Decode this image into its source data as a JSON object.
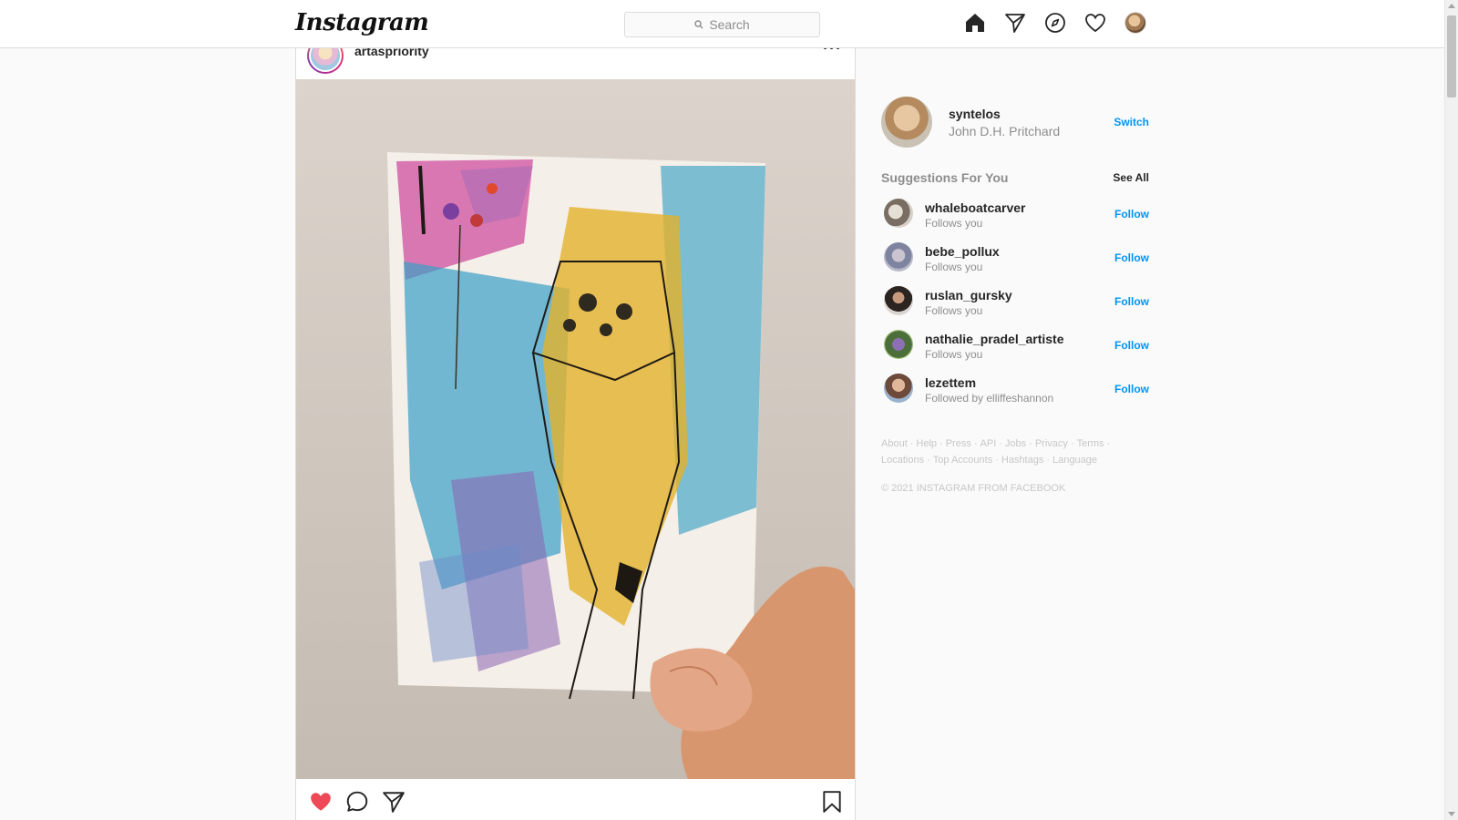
{
  "app": {
    "logo_text": "Instagram",
    "search_placeholder": "Search",
    "nav_icons": [
      "home-icon",
      "direct-icon",
      "explore-icon",
      "activity-heart-icon",
      "profile-avatar"
    ]
  },
  "post": {
    "username": "artaspriority",
    "more_label": "···",
    "image_description_icon": "watercolor-painting-photo",
    "liked": true,
    "accent_like_color": "#ed4956",
    "actions": [
      "like-heart-icon",
      "comment-icon",
      "share-icon",
      "save-bookmark-icon"
    ]
  },
  "me": {
    "username": "syntelos",
    "full_name": "John D.H. Pritchard",
    "switch_label": "Switch"
  },
  "suggestions": {
    "title": "Suggestions For You",
    "see_all": "See All",
    "items": [
      {
        "username": "whaleboatcarver",
        "subtitle": "Follows you",
        "action": "Follow"
      },
      {
        "username": "bebe_pollux",
        "subtitle": "Follows you",
        "action": "Follow"
      },
      {
        "username": "ruslan_gursky",
        "subtitle": "Follows you",
        "action": "Follow"
      },
      {
        "username": "nathalie_pradel_artiste",
        "subtitle": "Follows you",
        "action": "Follow"
      },
      {
        "username": "lezettem",
        "subtitle": "Followed by elliffeshannon",
        "action": "Follow"
      }
    ]
  },
  "footer": {
    "links": [
      "About",
      "Help",
      "Press",
      "API",
      "Jobs",
      "Privacy",
      "Terms",
      "Locations",
      "Top Accounts",
      "Hashtags",
      "Language"
    ],
    "separator": "·",
    "copyright": "© 2021 INSTAGRAM FROM FACEBOOK"
  },
  "colors": {
    "link_blue": "#0095f6",
    "muted_gray": "#8e8e8e",
    "border": "#dbdbdb"
  }
}
